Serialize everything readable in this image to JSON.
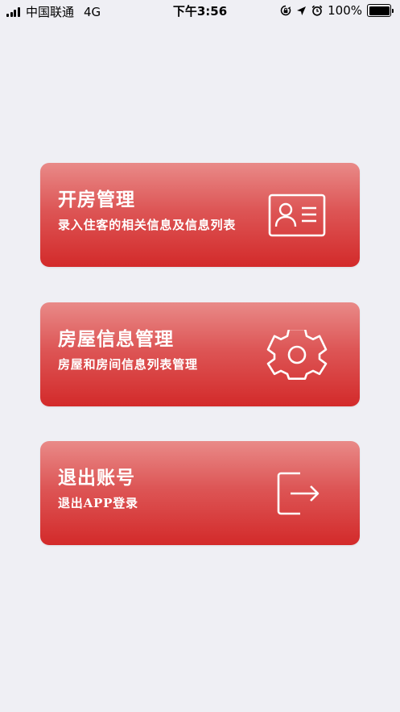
{
  "status_bar": {
    "carrier": "中国联通",
    "network": "4G",
    "time": "下午3:56",
    "battery": "100%",
    "icons": [
      "signal-icon",
      "lock-rotation-icon",
      "location-icon",
      "alarm-icon",
      "battery-icon"
    ]
  },
  "menu": [
    {
      "title": "开房管理",
      "subtitle": "录入住客的相关信息及信息列表",
      "icon": "id-card-icon"
    },
    {
      "title": "房屋信息管理",
      "subtitle": "房屋和房间信息列表管理",
      "icon": "gear-icon"
    },
    {
      "title": "退出账号",
      "subtitle": "退出APP登录",
      "icon": "logout-icon"
    }
  ],
  "theme": {
    "background": "#EFEFF4",
    "card_top": "#E98A88",
    "card_bottom": "#D32A2A"
  }
}
